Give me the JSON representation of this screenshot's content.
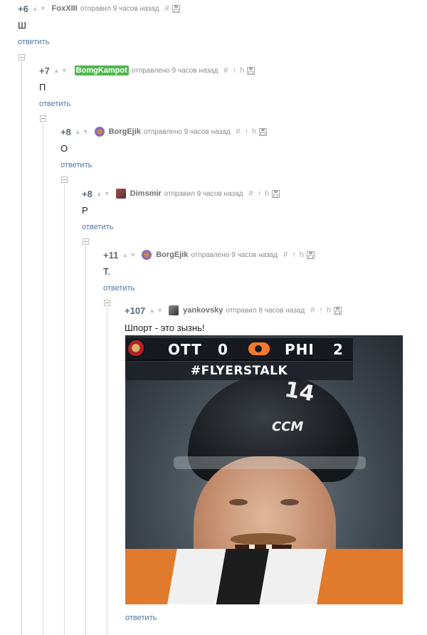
{
  "comments": [
    {
      "rating": "+6",
      "author": "FoxXIII",
      "meta": "отправил 9 часов назад",
      "text": "Ш",
      "reply": "ответить"
    },
    {
      "rating": "+7",
      "author": "BomgKampot",
      "meta": "отправлено 9 часов назад",
      "text": "П",
      "reply": "ответить"
    },
    {
      "rating": "+8",
      "author": "BorgEjik",
      "meta": "отправлено 9 часов назад",
      "text": "О",
      "reply": "ответить"
    },
    {
      "rating": "+8",
      "author": "Dimsmir",
      "meta": "отправил 9 часов назад",
      "text": "Р",
      "reply": "ответить"
    },
    {
      "rating": "+11",
      "author": "BorgEjik",
      "meta": "отправлено 9 часов назад",
      "text": "Т.",
      "reply": "ответить"
    },
    {
      "rating": "+107",
      "author": "yankovsky",
      "meta": "отправил 8 часов назад",
      "text": "Шпорт - это зызнь!",
      "reply": "ответить"
    }
  ],
  "image": {
    "team_home": "OTT",
    "score_home": "0",
    "team_away": "PHI",
    "score_away": "2",
    "hashtag": "#FLYERSTALK",
    "helmet_number": "14",
    "helmet_brand": "CCM"
  },
  "icons": {
    "collapse": "minus-box-icon",
    "hash": "hash-icon",
    "save": "floppy-disk-icon",
    "up": "arrow-up-icon",
    "mention": "reply-hook-icon",
    "vote_up": "triangle-up-icon",
    "vote_down": "triangle-down-icon"
  },
  "colors": {
    "link": "#4a77a8",
    "author_badge": "#4fb64d",
    "rating": "#5f6a75"
  }
}
